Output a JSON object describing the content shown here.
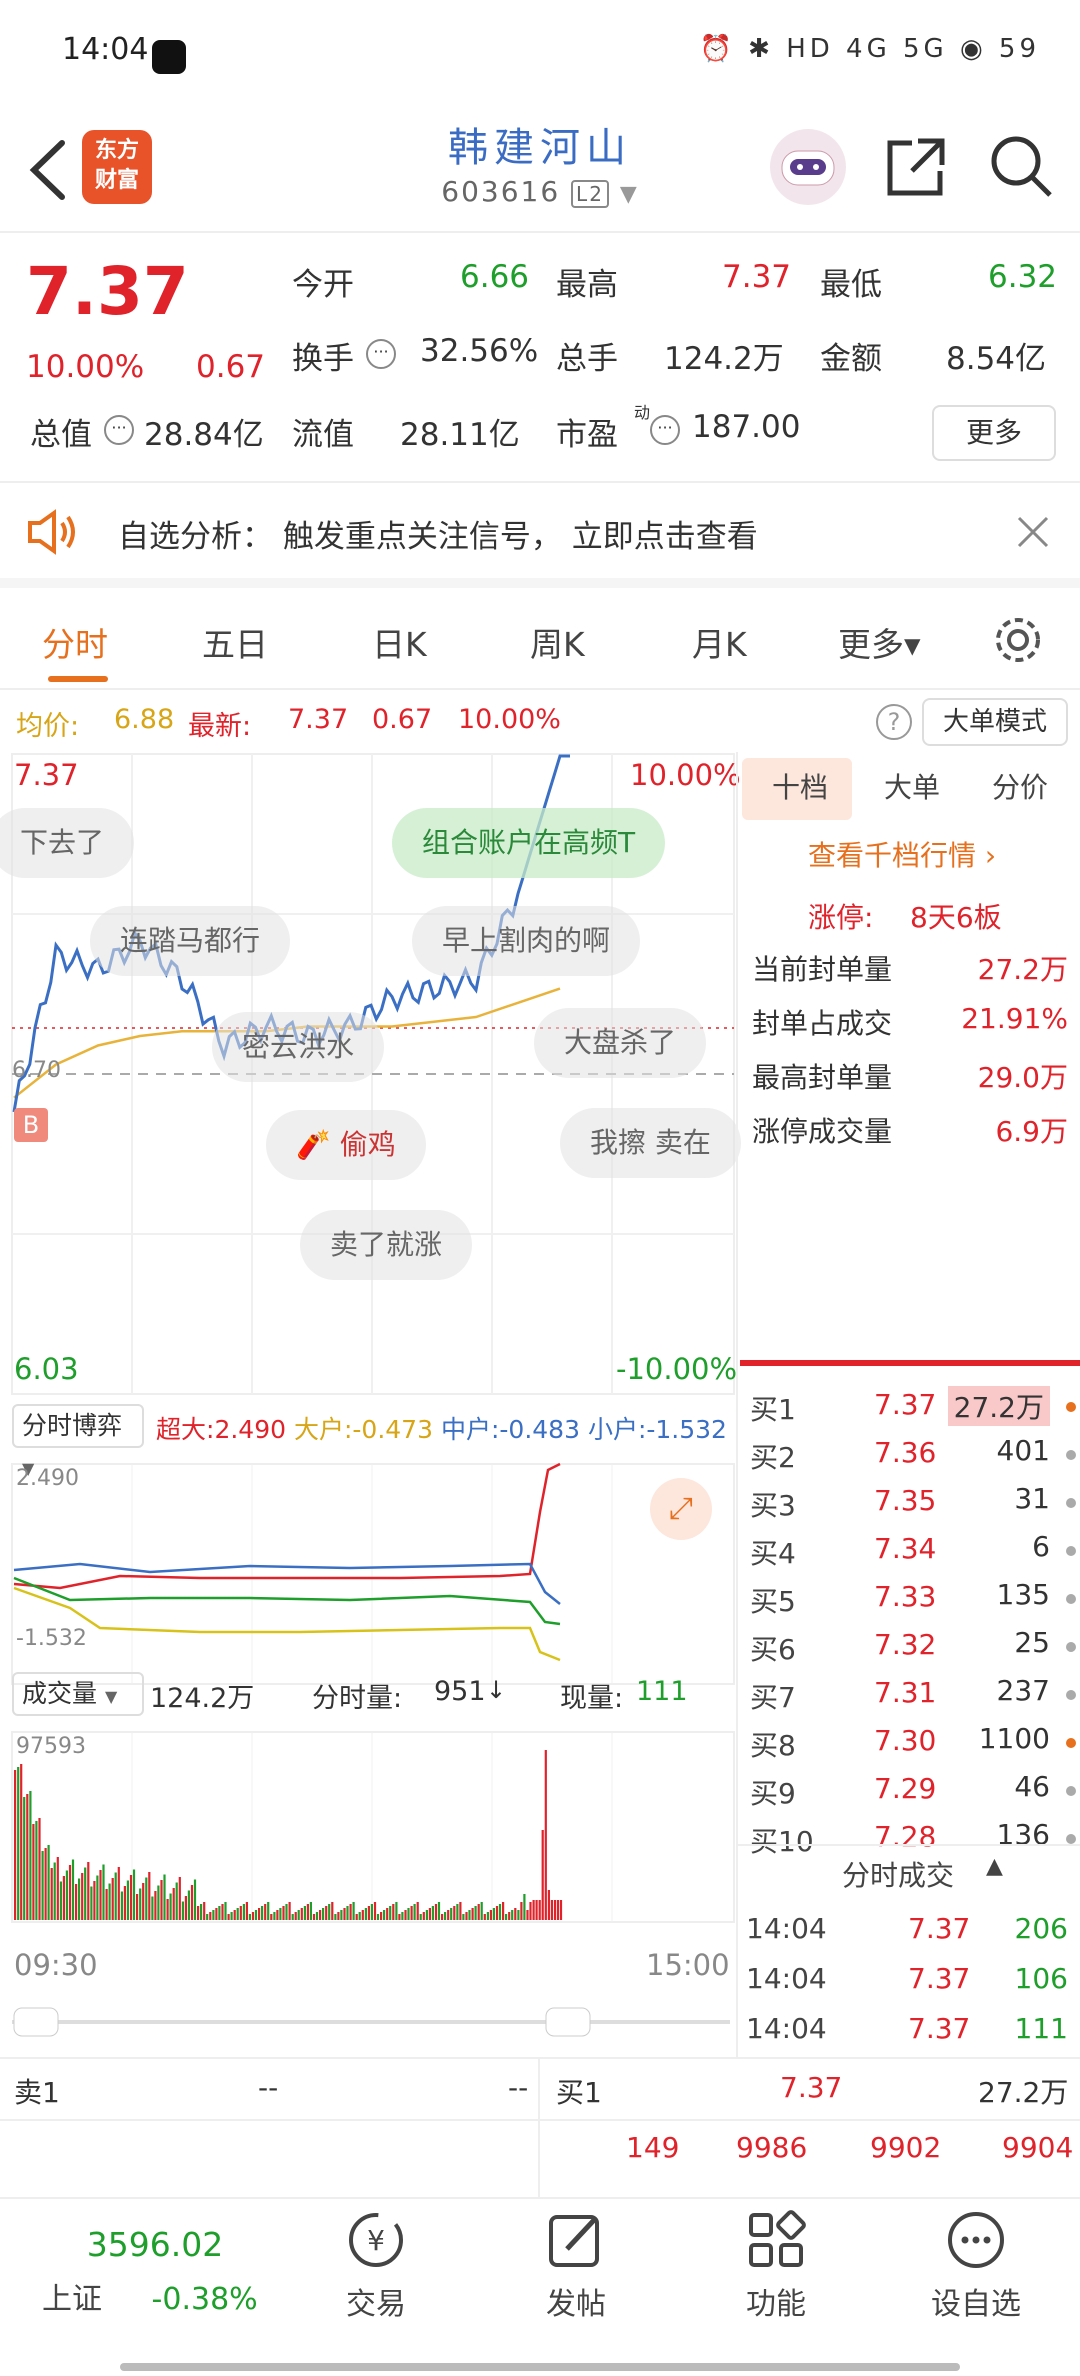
{
  "status_bar": {
    "time": "14:04",
    "icons": "⏰ ✱ HD 4G 5G ◉ 59",
    "battery": "59"
  },
  "header": {
    "logo_text": "东方\n财富",
    "stock_name": "韩建河山",
    "stock_code": "603616",
    "level_badge": "L2"
  },
  "quote": {
    "price": "7.37",
    "change_pct": "10.00%",
    "change_amt": "0.67",
    "open_label": "今开",
    "open": "6.66",
    "high_label": "最高",
    "high": "7.37",
    "low_label": "最低",
    "low": "6.32",
    "turnover_label": "换手",
    "turnover": "32.56%",
    "volume_label": "总手",
    "volume": "124.2万",
    "amount_label": "金额",
    "amount": "8.54亿",
    "mktcap_label": "总值",
    "mktcap": "28.84亿",
    "float_label": "流值",
    "float": "28.11亿",
    "pe_label": "市盈",
    "pe_sup": "动",
    "pe": "187.00",
    "more": "更多"
  },
  "notice": {
    "text": "自选分析：  触发重点关注信号，  立即点击查看"
  },
  "tabs": [
    {
      "label": "分时",
      "active": true
    },
    {
      "label": "五日"
    },
    {
      "label": "日K"
    },
    {
      "label": "周K"
    },
    {
      "label": "月K"
    },
    {
      "label": "更多▾"
    }
  ],
  "avg_bar": {
    "avg_label": "均价:",
    "avg": "6.88",
    "latest_label": "最新:",
    "latest": "7.37",
    "chg": "0.67",
    "pct": "10.00%",
    "mode_button": "大单模式"
  },
  "chart": {
    "top_price": "7.37",
    "top_pct": "10.00%",
    "bottom_price": "6.03",
    "bottom_pct": "-10.00%",
    "mid_price": "6.70",
    "b_marker": "B",
    "flow_selector": "分时博弈",
    "flow_super_label": "超大:",
    "flow_super": "2.490",
    "flow_big_label": "大户:",
    "flow_big": "-0.473",
    "flow_mid_label": "中户:",
    "flow_mid": "-0.483",
    "flow_small_label": "小户:",
    "flow_small": "-1.532",
    "flow_max": "2.490",
    "flow_min": "-1.532",
    "vol_selector": "成交量",
    "vol_total": "124.2万",
    "vol_minute_label": "分时量:",
    "vol_minute": "951",
    "vol_now_label": "现量:",
    "vol_now": "111",
    "vol_max": "97593",
    "time_start": "09:30",
    "time_end": "15:00"
  },
  "chart_data": {
    "type": "line",
    "x": [
      "09:30",
      "09:45",
      "10:00",
      "10:15",
      "10:30",
      "10:45",
      "11:00",
      "11:15",
      "11:30",
      "13:15",
      "13:30",
      "13:45",
      "14:00",
      "14:04"
    ],
    "series": [
      {
        "name": "price",
        "values": [
          6.62,
          6.95,
          6.92,
          6.98,
          6.9,
          6.76,
          6.8,
          6.78,
          6.8,
          6.86,
          6.88,
          6.9,
          7.08,
          7.37
        ]
      },
      {
        "name": "avg",
        "values": [
          6.65,
          6.72,
          6.76,
          6.78,
          6.79,
          6.79,
          6.79,
          6.8,
          6.8,
          6.8,
          6.81,
          6.82,
          6.85,
          6.88
        ]
      }
    ],
    "ylim": [
      6.03,
      7.37
    ]
  },
  "bubbles": [
    "下去了",
    "组合账户在高频T",
    "连踏马都行",
    "早上割肉的啊",
    "密云洪水",
    "大盘杀了",
    "偷鸡",
    "我擦 卖在",
    "卖了就涨"
  ],
  "right_panel": {
    "tabs": [
      "十档",
      "大单",
      "分价"
    ],
    "link": "查看千档行情 ›",
    "limit_label": "涨停:",
    "limit_value": "8天6板",
    "rows": [
      {
        "label": "当前封单量",
        "value": "27.2万"
      },
      {
        "label": "封单占成交",
        "value": "21.91%"
      },
      {
        "label": "最高封单量",
        "value": "29.0万"
      },
      {
        "label": "涨停成交量",
        "value": "6.9万"
      }
    ],
    "bids": [
      {
        "label": "买1",
        "price": "7.37",
        "vol": "27.2万",
        "dot": "#e6701e"
      },
      {
        "label": "买2",
        "price": "7.36",
        "vol": "401",
        "dot": "#aaa"
      },
      {
        "label": "买3",
        "price": "7.35",
        "vol": "31",
        "dot": "#aaa"
      },
      {
        "label": "买4",
        "price": "7.34",
        "vol": "6",
        "dot": "#aaa"
      },
      {
        "label": "买5",
        "price": "7.33",
        "vol": "135",
        "dot": "#aaa"
      },
      {
        "label": "买6",
        "price": "7.32",
        "vol": "25",
        "dot": "#aaa"
      },
      {
        "label": "买7",
        "price": "7.31",
        "vol": "237",
        "dot": "#aaa"
      },
      {
        "label": "买8",
        "price": "7.30",
        "vol": "1100",
        "dot": "#e6701e"
      },
      {
        "label": "买9",
        "price": "7.29",
        "vol": "46",
        "dot": "#aaa"
      },
      {
        "label": "买10",
        "price": "7.28",
        "vol": "136",
        "dot": "#aaa"
      }
    ],
    "trades_title": "分时成交",
    "trades": [
      {
        "time": "14:04",
        "price": "7.37",
        "vol": "206"
      },
      {
        "time": "14:04",
        "price": "7.37",
        "vol": "106"
      },
      {
        "time": "14:04",
        "price": "7.37",
        "vol": "111"
      }
    ]
  },
  "bottom_line": {
    "sell1_label": "卖1",
    "sell1_price": "--",
    "sell1_vol": "--",
    "buy1_label": "买1",
    "buy1_price": "7.37",
    "buy1_vol": "27.2万",
    "ticks": [
      "149",
      "9986",
      "9902",
      "9904"
    ]
  },
  "nav": {
    "index_value": "3596.02",
    "index_name": "上证",
    "index_pct": "-0.38%",
    "items": [
      "交易",
      "发帖",
      "功能",
      "设自选"
    ]
  }
}
